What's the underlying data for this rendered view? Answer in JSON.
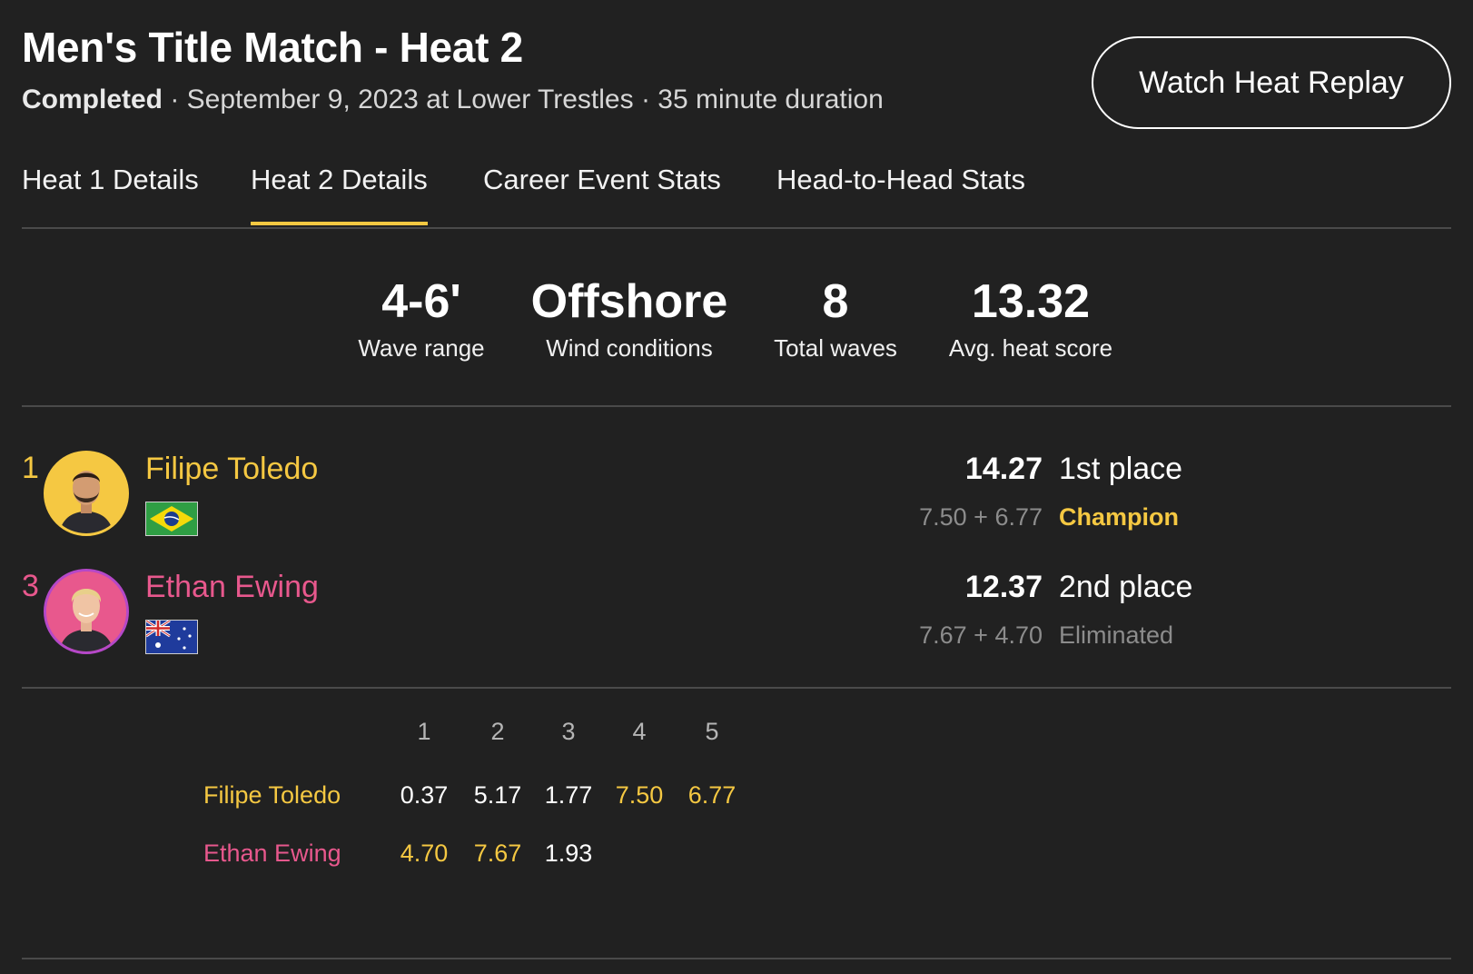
{
  "header": {
    "title": "Men's Title Match - Heat 2",
    "status": "Completed",
    "details": " · September 9, 2023 at Lower Trestles · 35 minute duration",
    "replay_label": "Watch Heat Replay"
  },
  "tabs": [
    {
      "label": "Heat 1 Details",
      "active": false
    },
    {
      "label": "Heat 2 Details",
      "active": true
    },
    {
      "label": "Career Event Stats",
      "active": false
    },
    {
      "label": "Head-to-Head Stats",
      "active": false
    }
  ],
  "stats": [
    {
      "value": "4-6'",
      "label": "Wave range"
    },
    {
      "value": "Offshore",
      "label": "Wind conditions"
    },
    {
      "value": "8",
      "label": "Total waves"
    },
    {
      "value": "13.32",
      "label": "Avg. heat score"
    }
  ],
  "athletes": [
    {
      "seed": "1",
      "name": "Filipe Toledo",
      "flag": "brazil-flag",
      "total": "14.27",
      "breakdown": "7.50 + 6.77",
      "place": "1st place",
      "result": "Champion",
      "color": "#f5c842"
    },
    {
      "seed": "3",
      "name": "Ethan Ewing",
      "flag": "australia-flag",
      "total": "12.37",
      "breakdown": "7.67 + 4.70",
      "place": "2nd place",
      "result": "Eliminated",
      "color": "#e8588d"
    }
  ],
  "wave_table": {
    "headers": [
      "1",
      "2",
      "3",
      "4",
      "5"
    ],
    "rows": [
      {
        "name": "Filipe Toledo",
        "scores": [
          {
            "value": "0.37",
            "counting": false
          },
          {
            "value": "5.17",
            "counting": false
          },
          {
            "value": "1.77",
            "counting": false
          },
          {
            "value": "7.50",
            "counting": true
          },
          {
            "value": "6.77",
            "counting": true
          }
        ]
      },
      {
        "name": "Ethan Ewing",
        "scores": [
          {
            "value": "4.70",
            "counting": true
          },
          {
            "value": "7.67",
            "counting": true
          },
          {
            "value": "1.93",
            "counting": false
          }
        ]
      }
    ]
  },
  "colors": {
    "background": "#212121",
    "accent_yellow": "#f5c842",
    "accent_pink": "#e8588d",
    "divider": "#4a4a4a"
  }
}
